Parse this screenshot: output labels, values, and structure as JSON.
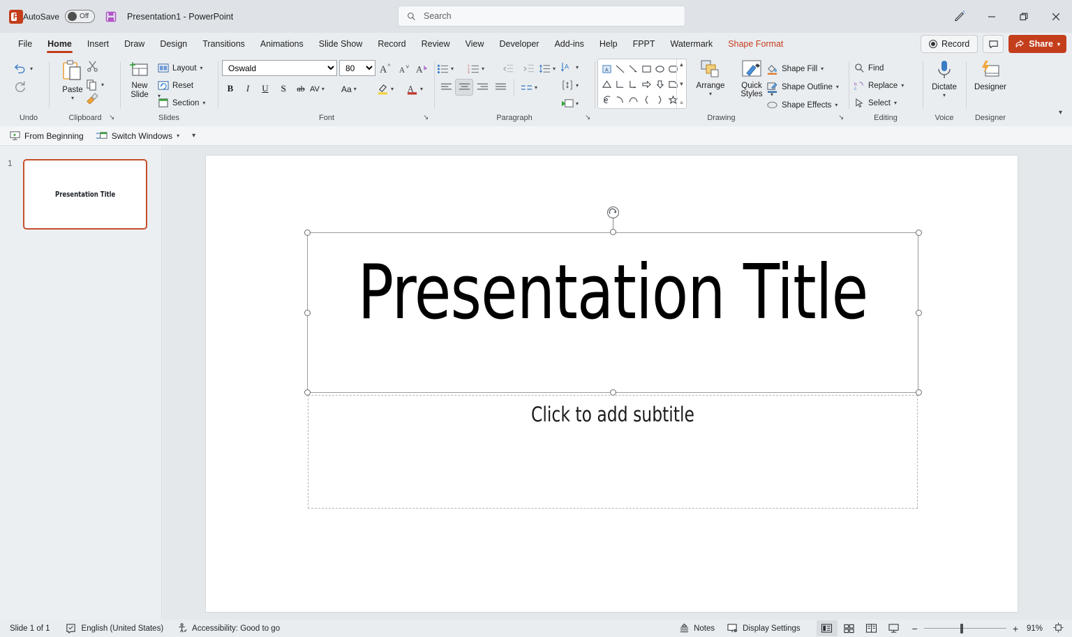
{
  "titlebar": {
    "app_icon": "powerpoint-logo",
    "autosave_label": "AutoSave",
    "autosave_state": "Off",
    "save_icon": "save-icon",
    "document_title": "Presentation1  -  PowerPoint",
    "search_placeholder": "Search",
    "search_icon": "search-icon",
    "pen_icon": "pen-feedback-icon",
    "minimize": "minimize-icon",
    "restore": "restore-icon",
    "close": "close-icon"
  },
  "tabs": [
    {
      "label": "File",
      "active": false,
      "contextual": false
    },
    {
      "label": "Home",
      "active": true,
      "contextual": false
    },
    {
      "label": "Insert",
      "active": false,
      "contextual": false
    },
    {
      "label": "Draw",
      "active": false,
      "contextual": false
    },
    {
      "label": "Design",
      "active": false,
      "contextual": false
    },
    {
      "label": "Transitions",
      "active": false,
      "contextual": false
    },
    {
      "label": "Animations",
      "active": false,
      "contextual": false
    },
    {
      "label": "Slide Show",
      "active": false,
      "contextual": false
    },
    {
      "label": "Record",
      "active": false,
      "contextual": false
    },
    {
      "label": "Review",
      "active": false,
      "contextual": false
    },
    {
      "label": "View",
      "active": false,
      "contextual": false
    },
    {
      "label": "Developer",
      "active": false,
      "contextual": false
    },
    {
      "label": "Add-ins",
      "active": false,
      "contextual": false
    },
    {
      "label": "Help",
      "active": false,
      "contextual": false
    },
    {
      "label": "FPPT",
      "active": false,
      "contextual": false
    },
    {
      "label": "Watermark",
      "active": false,
      "contextual": false
    },
    {
      "label": "Shape Format",
      "active": false,
      "contextual": true
    }
  ],
  "tabbar_right": {
    "record_label": "Record",
    "comment_icon": "comment-icon",
    "share_label": "Share"
  },
  "ribbon": {
    "groups": [
      {
        "name": "Undo",
        "label": "Undo"
      },
      {
        "name": "Clipboard",
        "label": "Clipboard"
      },
      {
        "name": "Slides",
        "label": "Slides"
      },
      {
        "name": "Font",
        "label": "Font"
      },
      {
        "name": "Paragraph",
        "label": "Paragraph"
      },
      {
        "name": "Drawing",
        "label": "Drawing"
      },
      {
        "name": "Editing",
        "label": "Editing"
      },
      {
        "name": "Voice",
        "label": "Voice"
      },
      {
        "name": "Designer",
        "label": "Designer"
      }
    ],
    "undo": {
      "undo_icon": "undo-icon",
      "redo_icon": "redo-icon"
    },
    "clipboard": {
      "paste_label": "Paste",
      "cut_icon": "scissors-icon",
      "copy_icon": "copy-icon",
      "format_painter_icon": "format-painter-icon"
    },
    "slides": {
      "new_slide_label": "New Slide",
      "layout_label": "Layout",
      "reset_label": "Reset",
      "section_label": "Section"
    },
    "font": {
      "font_name": "Oswald",
      "font_size": "80",
      "grow_font": "increase-font-size-icon",
      "shrink_font": "decrease-font-size-icon",
      "clear_formatting": "clear-formatting-icon",
      "bold": "B",
      "italic": "I",
      "underline": "U",
      "shadow": "S",
      "strikethrough": "ab",
      "char_spacing": "AV",
      "change_case": "Aa",
      "highlight_color": "text-highlight-icon",
      "font_color": "font-color-icon"
    },
    "paragraph": {
      "bullets": "bullets-icon",
      "numbering": "numbering-icon",
      "decrease_indent": "decrease-indent-icon",
      "increase_indent": "increase-indent-icon",
      "line_spacing": "line-spacing-icon",
      "align_left": "align-left-icon",
      "align_center": "align-center-icon",
      "align_right": "align-right-icon",
      "justify": "justify-icon",
      "columns": "columns-icon",
      "text_direction": "text-direction-icon",
      "align_text": "align-text-icon",
      "smartart": "convert-to-smartart-icon",
      "active_alignment": "align-center"
    },
    "drawing": {
      "shapes": [
        "text-box",
        "line",
        "line-arrow",
        "rectangle",
        "oval",
        "rounded-rectangle",
        "triangle",
        "right-bracket-corner",
        "elbow-connector",
        "right-arrow",
        "down-arrow",
        "pentagon-tag",
        "scribble",
        "arc",
        "curve",
        "left-brace",
        "right-brace",
        "star"
      ],
      "arrange_label": "Arrange",
      "quick_styles_label": "Quick Styles",
      "shape_fill_label": "Shape Fill",
      "shape_outline_label": "Shape Outline",
      "shape_effects_label": "Shape Effects"
    },
    "editing": {
      "find_label": "Find",
      "replace_label": "Replace",
      "select_label": "Select"
    },
    "voice": {
      "dictate_label": "Dictate"
    },
    "designer": {
      "designer_label": "Designer"
    },
    "collapse_icon": "collapse-ribbon-icon"
  },
  "qat": {
    "from_beginning_label": "From Beginning",
    "switch_windows_label": "Switch Windows",
    "overflow_icon": "more-commands-icon"
  },
  "thumbnails": [
    {
      "number": "1",
      "title": "Presentation Title",
      "selected": true
    }
  ],
  "slide": {
    "title_text": "Presentation Title",
    "subtitle_placeholder": "Click to add subtitle",
    "rotate_handle": "rotate-handle-icon"
  },
  "statusbar": {
    "slide_count": "Slide 1 of 1",
    "spellcheck_icon": "spellcheck-icon",
    "language": "English (United States)",
    "accessibility_icon": "accessibility-icon",
    "accessibility": "Accessibility: Good to go",
    "notes_label": "Notes",
    "display_settings_label": "Display Settings",
    "views": [
      "normal-view",
      "slide-sorter-view",
      "reading-view",
      "slide-show-view"
    ],
    "active_view": "normal-view",
    "zoom_out": "−",
    "zoom_in": "+",
    "zoom_level": "91%",
    "fit_slide_icon": "fit-to-window-icon"
  },
  "colors": {
    "accent": "#c43e1c",
    "chrome": "#e9edf0",
    "titlebar": "#dfe3e8",
    "canvas": "#e4e8eb"
  }
}
